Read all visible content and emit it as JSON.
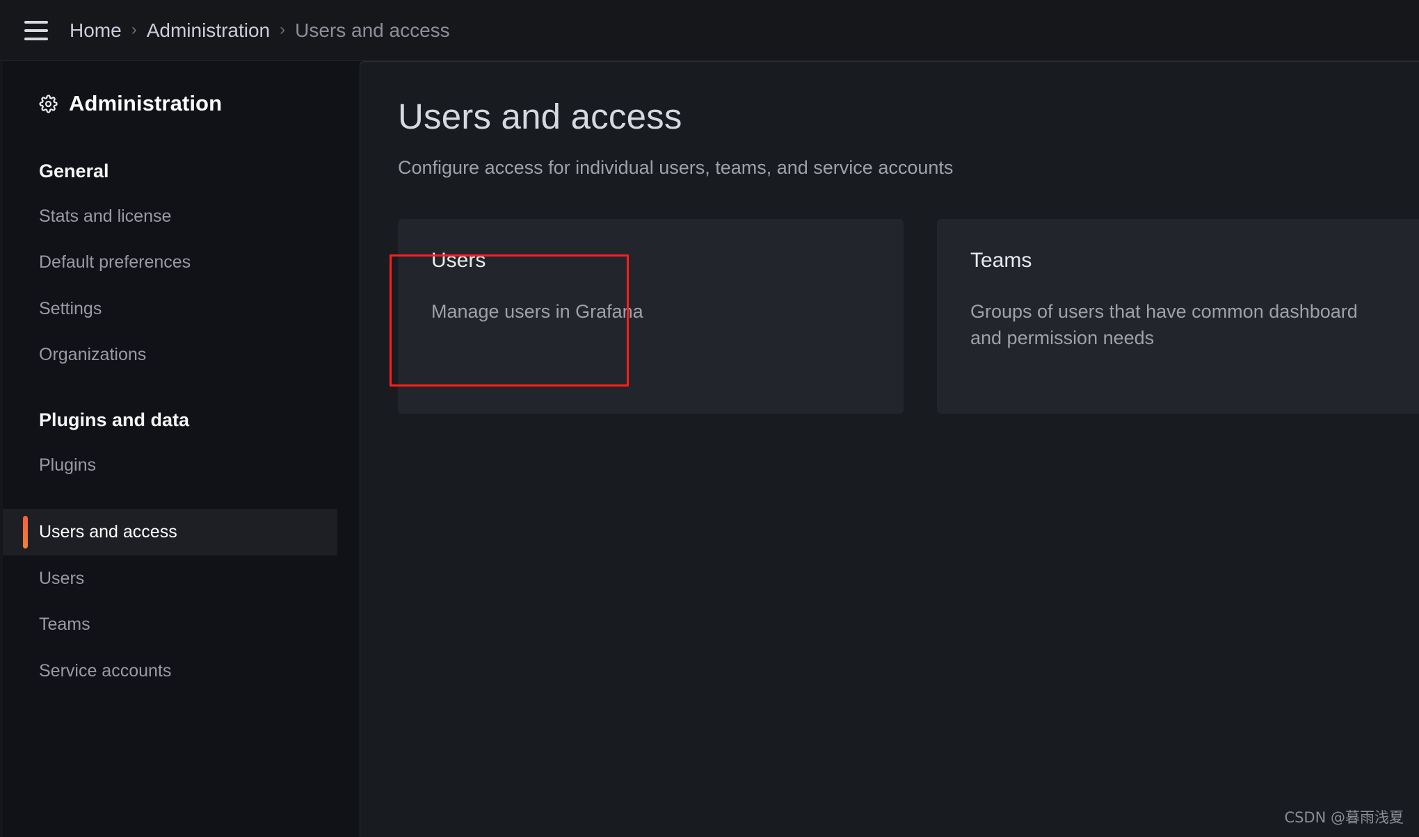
{
  "topbar": {
    "menu_icon": "hamburger-menu-icon",
    "breadcrumb": [
      {
        "label": "Home",
        "current": false
      },
      {
        "label": "Administration",
        "current": false
      },
      {
        "label": "Users and access",
        "current": true
      }
    ],
    "separator": "›"
  },
  "sidebar": {
    "icon": "gear-icon",
    "title": "Administration",
    "sections": [
      {
        "header": "General",
        "items": [
          {
            "label": "Stats and license",
            "active": false
          },
          {
            "label": "Default preferences",
            "active": false
          },
          {
            "label": "Settings",
            "active": false
          },
          {
            "label": "Organizations",
            "active": false
          }
        ]
      },
      {
        "header": "Plugins and data",
        "items": [
          {
            "label": "Plugins",
            "active": false
          }
        ]
      },
      {
        "header": null,
        "items": [
          {
            "label": "Users and access",
            "active": true
          },
          {
            "label": "Users",
            "active": false
          },
          {
            "label": "Teams",
            "active": false
          },
          {
            "label": "Service accounts",
            "active": false
          }
        ]
      }
    ]
  },
  "main": {
    "title": "Users and access",
    "subtitle": "Configure access for individual users, teams, and service accounts",
    "cards": [
      {
        "title": "Users",
        "description": "Manage users in Grafana",
        "highlighted": true
      },
      {
        "title": "Teams",
        "description": "Groups of users that have common dashboard and permission needs",
        "highlighted": false
      }
    ]
  },
  "annotation": {
    "color": "#ff1e1e",
    "target": "users-card"
  },
  "watermark": {
    "text": "CSDN @暮雨浅夏"
  },
  "colors": {
    "app_background": "#111217",
    "topbar_background": "#16171b",
    "panel_background": "#181b1f",
    "card_background": "#22252b",
    "active_nav_background": "#1d1f24",
    "accent_orange": "#f55f3e",
    "text_primary": "#d8d9e0",
    "text_secondary": "#9fa0ab"
  }
}
